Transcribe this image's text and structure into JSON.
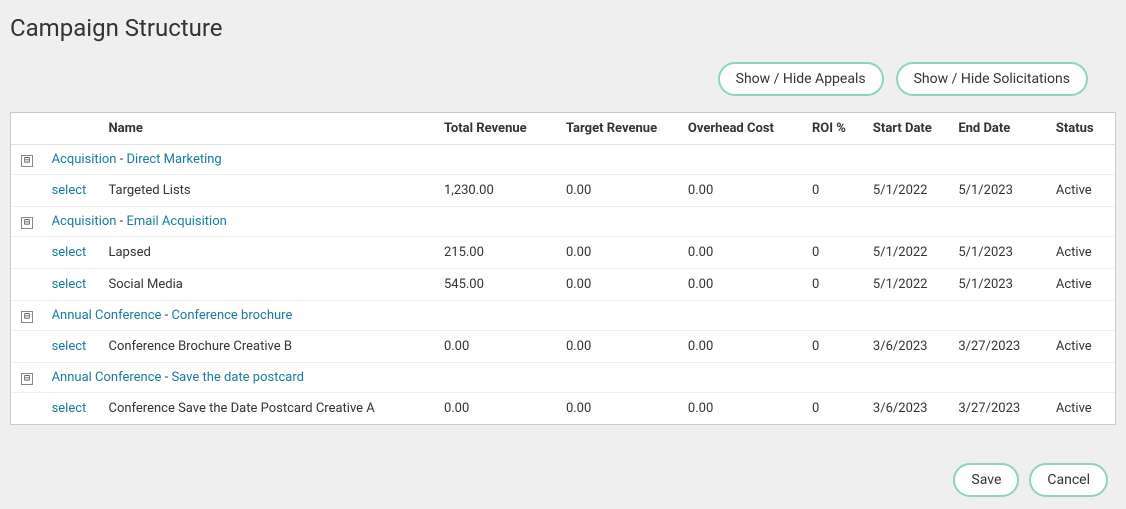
{
  "page": {
    "title": "Campaign Structure"
  },
  "toolbar": {
    "toggle_appeals": "Show / Hide Appeals",
    "toggle_solicitations": "Show / Hide Solicitations"
  },
  "table": {
    "headers": {
      "name": "Name",
      "total_revenue": "Total Revenue",
      "target_revenue": "Target Revenue",
      "overhead_cost": "Overhead Cost",
      "roi_pct": "ROI %",
      "start_date": "Start Date",
      "end_date": "End Date",
      "status": "Status"
    },
    "select_label": "select",
    "group_separator": " - ",
    "groups": [
      {
        "toggle": "⊟",
        "campaign": "Acquisition",
        "appeal": "Direct Marketing",
        "rows": [
          {
            "name": "Targeted Lists",
            "total_revenue": "1,230.00",
            "target_revenue": "0.00",
            "overhead_cost": "0.00",
            "roi_pct": "0",
            "start_date": "5/1/2022",
            "end_date": "5/1/2023",
            "status": "Active"
          }
        ]
      },
      {
        "toggle": "⊟",
        "campaign": "Acquisition",
        "appeal": "Email Acquisition",
        "rows": [
          {
            "name": "Lapsed",
            "total_revenue": "215.00",
            "target_revenue": "0.00",
            "overhead_cost": "0.00",
            "roi_pct": "0",
            "start_date": "5/1/2022",
            "end_date": "5/1/2023",
            "status": "Active"
          },
          {
            "name": "Social Media",
            "total_revenue": "545.00",
            "target_revenue": "0.00",
            "overhead_cost": "0.00",
            "roi_pct": "0",
            "start_date": "5/1/2022",
            "end_date": "5/1/2023",
            "status": "Active"
          }
        ]
      },
      {
        "toggle": "⊟",
        "campaign": "Annual Conference",
        "appeal": "Conference brochure",
        "rows": [
          {
            "name": "Conference Brochure Creative B",
            "total_revenue": "0.00",
            "target_revenue": "0.00",
            "overhead_cost": "0.00",
            "roi_pct": "0",
            "start_date": "3/6/2023",
            "end_date": "3/27/2023",
            "status": "Active"
          }
        ]
      },
      {
        "toggle": "⊟",
        "campaign": "Annual Conference",
        "appeal": "Save the date postcard",
        "rows": [
          {
            "name": "Conference Save the Date Postcard Creative A",
            "total_revenue": "0.00",
            "target_revenue": "0.00",
            "overhead_cost": "0.00",
            "roi_pct": "0",
            "start_date": "3/6/2023",
            "end_date": "3/27/2023",
            "status": "Active"
          }
        ]
      }
    ]
  },
  "footer": {
    "save": "Save",
    "cancel": "Cancel"
  }
}
